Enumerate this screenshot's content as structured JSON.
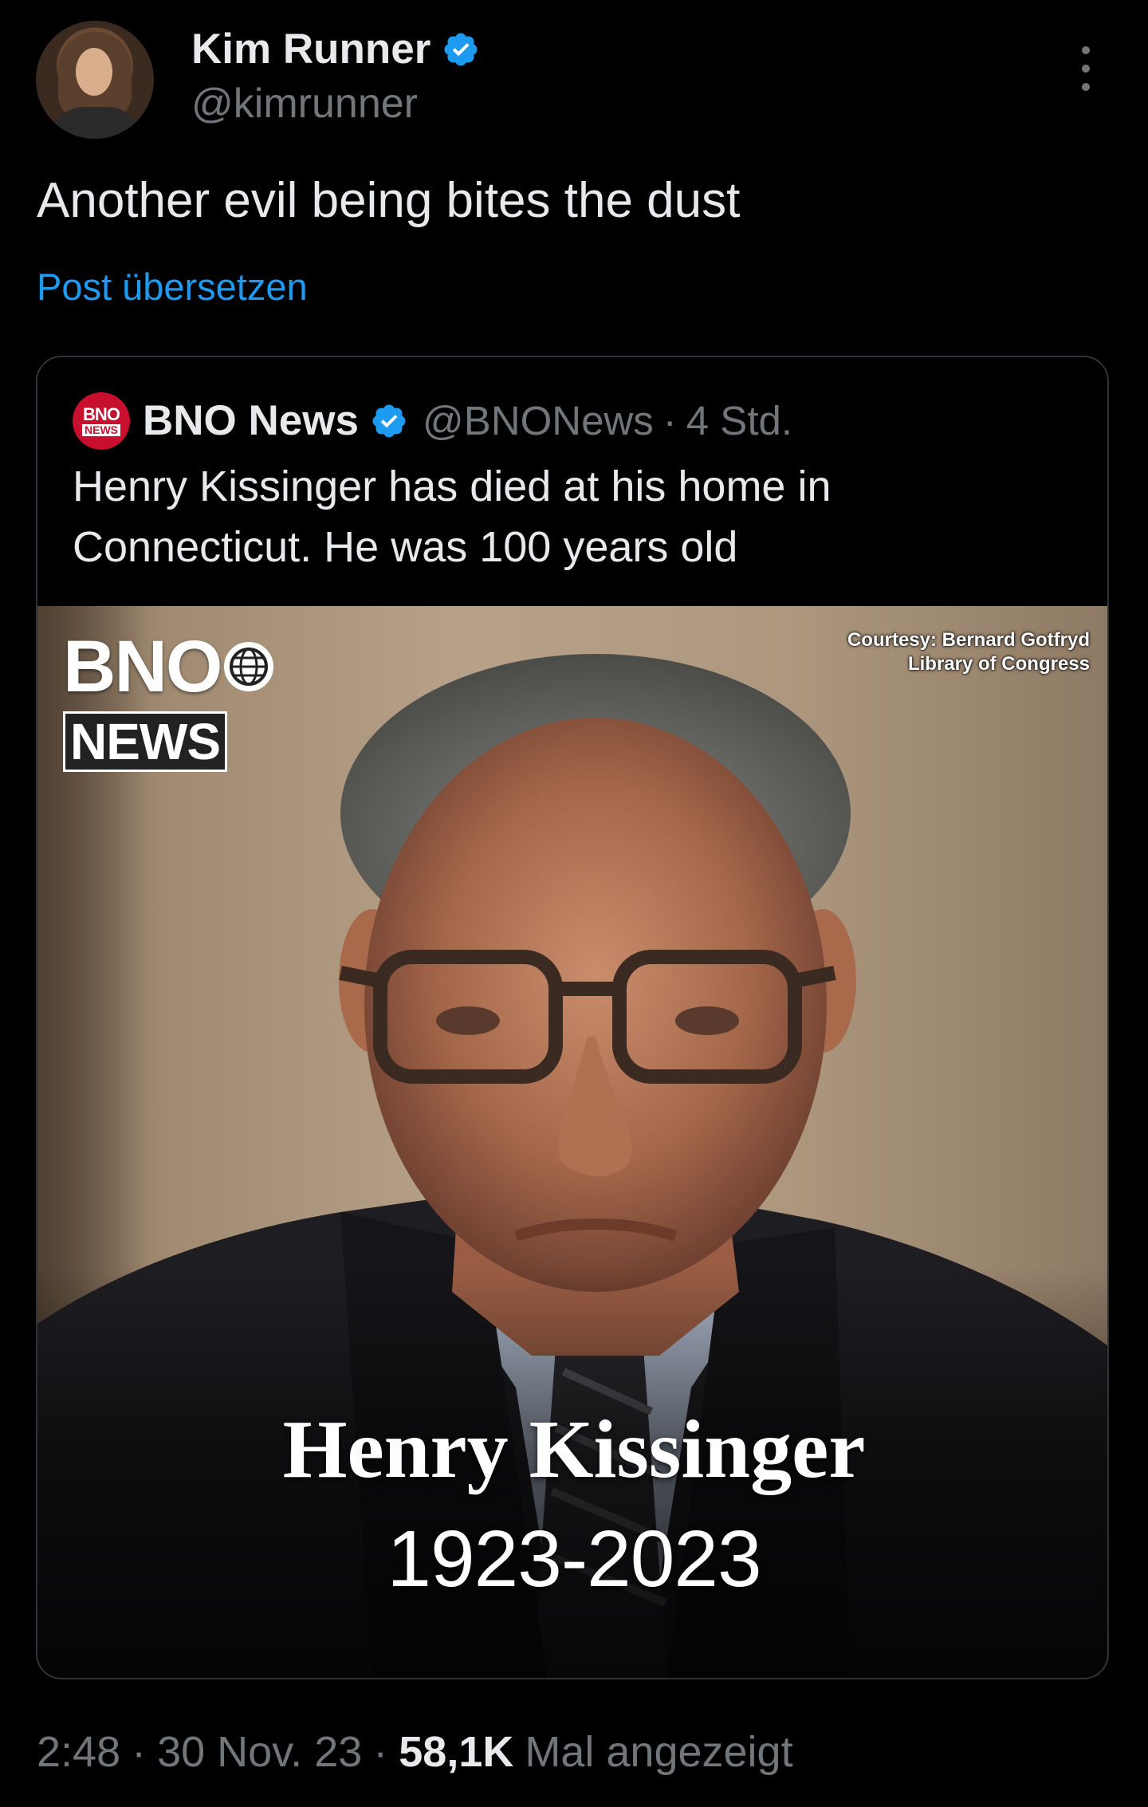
{
  "author": {
    "display_name": "Kim Runner",
    "handle": "@kimrunner",
    "verified": true
  },
  "post": {
    "text": "Another evil being bites the dust",
    "translate_label": "Post übersetzen"
  },
  "quote": {
    "logo_line1": "BNO",
    "logo_line2": "NEWS",
    "display_name": "BNO News",
    "handle": "@BNONews",
    "separator": "·",
    "time": "4 Std.",
    "text": "Henry Kissinger has died at his home in Connecticut. He was 100 years old",
    "image": {
      "logo_top": "BNO",
      "logo_bottom": "NEWS",
      "credit_line1": "Courtesy: Bernard Gotfryd",
      "credit_line2": "Library of Congress",
      "name": "Henry Kissinger",
      "years": "1923-2023"
    }
  },
  "meta": {
    "time": "2:48",
    "separator": "·",
    "date": "30 Nov. 23",
    "views_count": "58,1K",
    "views_label": "Mal angezeigt"
  },
  "colors": {
    "background": "#000000",
    "text_primary": "#e7e9ea",
    "text_secondary": "#71767b",
    "link": "#1d9bf0",
    "verified_badge": "#1d9bf0",
    "card_border": "#2f3336",
    "bno_red": "#c8102e"
  },
  "icons": {
    "verified": "verified-badge-icon",
    "more": "more-vertical-icon",
    "globe": "globe-icon"
  }
}
